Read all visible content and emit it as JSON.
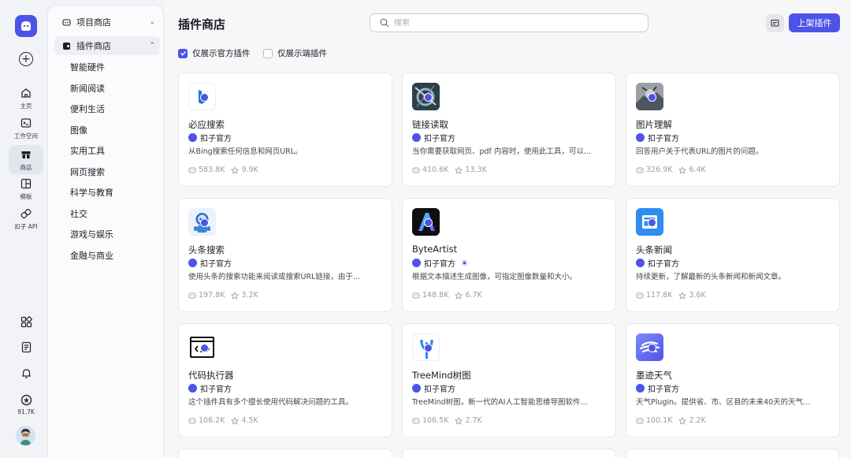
{
  "rail": {
    "nav": [
      {
        "id": "home",
        "label": "主页",
        "icon": "home-icon"
      },
      {
        "id": "workspace",
        "label": "工作空间",
        "icon": "terminal-icon"
      },
      {
        "id": "store",
        "label": "商店",
        "icon": "store-icon",
        "active": true
      },
      {
        "id": "templates",
        "label": "模板",
        "icon": "layout-icon"
      },
      {
        "id": "api",
        "label": "扣子 API",
        "icon": "link-icon"
      }
    ],
    "points": "91.7K"
  },
  "sidebar": {
    "project_store": "项目商店",
    "plugin_store": "插件商店",
    "categories": [
      "智能硬件",
      "新闻阅读",
      "便利生活",
      "图像",
      "实用工具",
      "网页搜索",
      "科学与教育",
      "社交",
      "游戏与娱乐",
      "金融与商业"
    ]
  },
  "header": {
    "title": "插件商店",
    "search_placeholder": "搜索",
    "publish_label": "上架插件"
  },
  "filters": {
    "official_only": "仅展示官方插件",
    "client_only": "仅展示端插件"
  },
  "colors": {
    "accent": "#4d53e8",
    "page_bg": "#f7f7fa"
  },
  "plugins": [
    {
      "name": "必应搜索",
      "author": "扣子官方",
      "desc": "从Bing搜索任何信息和网页URL。",
      "uses": "583.8K",
      "favs": "9.9K",
      "icon": "bing-icon"
    },
    {
      "name": "链接读取",
      "author": "扣子官方",
      "desc": "当你需要获取网页、pdf 内容时，使用此工具，可以…",
      "uses": "410.6K",
      "favs": "13.3K",
      "icon": "link-reader-icon"
    },
    {
      "name": "图片理解",
      "author": "扣子官方",
      "desc": "回答用户关于代表URL的图片的问题。",
      "uses": "326.9K",
      "favs": "6.4K",
      "icon": "image-understanding-icon"
    },
    {
      "name": "头条搜索",
      "author": "扣子官方",
      "desc": "使用头条的搜索功能来阅读或搜索URL链接，由于…",
      "uses": "197.8K",
      "favs": "3.2K",
      "icon": "robot-icon"
    },
    {
      "name": "ByteArtist",
      "author": "扣子官方",
      "desc": "根据文本描述生成图像，可指定图像数量和大小。",
      "uses": "148.8K",
      "favs": "6.7K",
      "icon": "byteartist-icon",
      "extra_badge": true
    },
    {
      "name": "头条新闻",
      "author": "扣子官方",
      "desc": "持续更新，了解最新的头条新闻和新闻文章。",
      "uses": "117.8K",
      "favs": "3.6K",
      "icon": "news-icon"
    },
    {
      "name": "代码执行器",
      "author": "扣子官方",
      "desc": "这个插件具有多个擅长使用代码解决问题的工具。",
      "uses": "106.2K",
      "favs": "4.5K",
      "icon": "code-icon"
    },
    {
      "name": "TreeMind树图",
      "author": "扣子官方",
      "desc": "TreeMind树图，新一代的AI人工智能思维导图软件…",
      "uses": "106.5K",
      "favs": "2.7K",
      "icon": "treemind-icon"
    },
    {
      "name": "墨迹天气",
      "author": "扣子官方",
      "desc": "天气Plugin。提供省、市、区县的未来40天的天气…",
      "uses": "100.1K",
      "favs": "2.2K",
      "icon": "weather-icon"
    }
  ]
}
